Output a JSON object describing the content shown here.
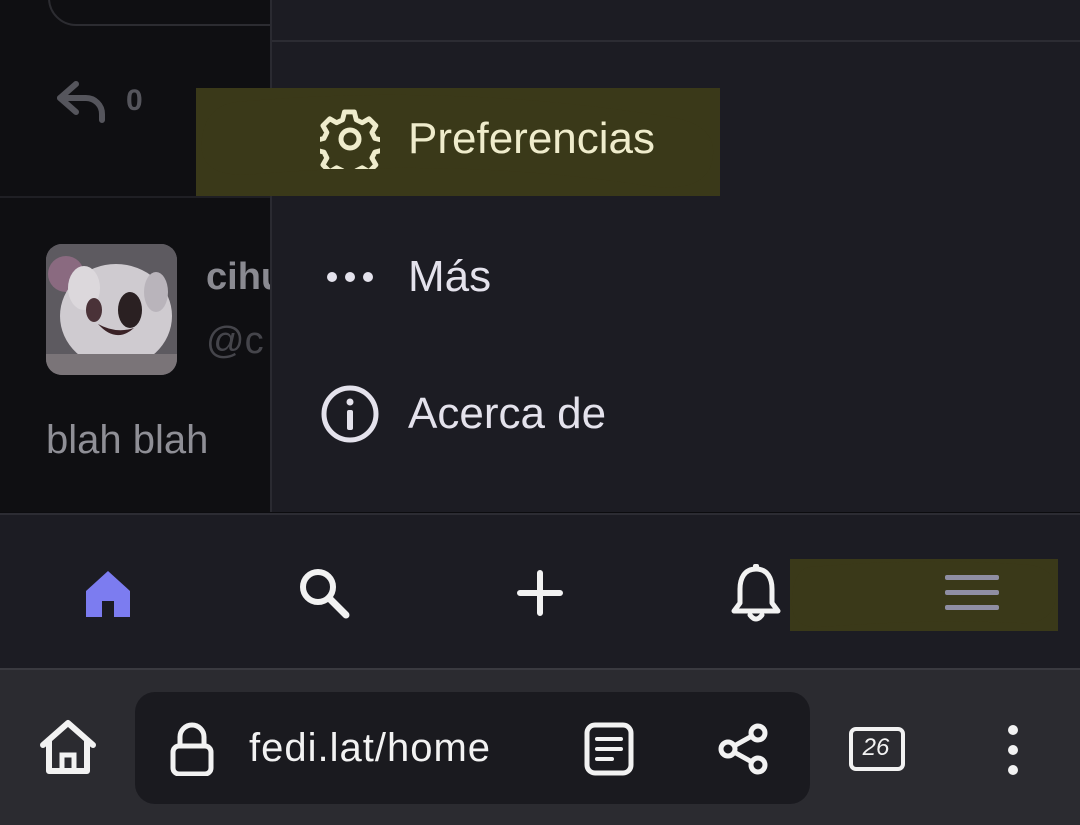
{
  "feed": {
    "reply_count": "0",
    "author_name": "cihu",
    "author_handle": "@c",
    "post_text": "blah blah"
  },
  "drawer": {
    "items": [
      {
        "label": "Preferencias",
        "icon": "gear-icon"
      },
      {
        "label": "Más",
        "icon": "more-dots-icon"
      },
      {
        "label": "Acerca de",
        "icon": "info-icon"
      }
    ]
  },
  "bottom_nav": {
    "items": [
      "home-icon",
      "search-icon",
      "compose-plus-icon",
      "bell-icon",
      "menu-icon"
    ],
    "active": "home-icon"
  },
  "browser": {
    "url": "fedi.lat/home",
    "tab_count": "26"
  },
  "colors": {
    "accent": "#7c7cf0",
    "highlight": "#3a3919",
    "drawer_bg": "#1c1c23",
    "browser_bar_bg": "#2b2b30"
  }
}
